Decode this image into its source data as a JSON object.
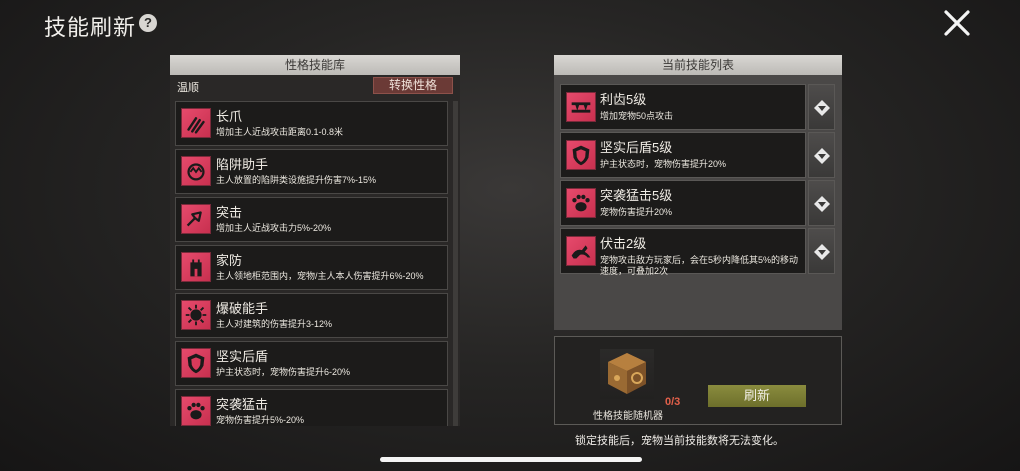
{
  "header": {
    "title": "技能刷新",
    "help_label": "?"
  },
  "library": {
    "title": "性格技能库",
    "personality": "温顺",
    "change_button": "转换性格",
    "skills": [
      {
        "name": "长爪",
        "desc": "增加主人近战攻击距离0.1-0.8米",
        "icon": "claw-icon"
      },
      {
        "name": "陷阱助手",
        "desc": "主人放置的陷阱类设施提升伤害7%-15%",
        "icon": "trap-icon"
      },
      {
        "name": "突击",
        "desc": "增加主人近战攻击力5%-20%",
        "icon": "assault-icon"
      },
      {
        "name": "家防",
        "desc": "主人领地柜范围内，宠物/主人本人伤害提升6%-20%",
        "icon": "tower-icon"
      },
      {
        "name": "爆破能手",
        "desc": "主人对建筑的伤害提升3-12%",
        "icon": "explosion-icon"
      },
      {
        "name": "坚实后盾",
        "desc": "护主状态时，宠物伤害提升6-20%",
        "icon": "shield-icon"
      },
      {
        "name": "突袭猛击",
        "desc": "宠物伤害提升5%-20%",
        "icon": "paw-icon"
      }
    ]
  },
  "current": {
    "title": "当前技能列表",
    "skills": [
      {
        "name": "利齿5级",
        "desc": "增加宠物50点攻击",
        "icon": "fang-icon"
      },
      {
        "name": "坚实后盾5级",
        "desc": "护主状态时，宠物伤害提升20%",
        "icon": "shield-icon"
      },
      {
        "name": "突袭猛击5级",
        "desc": "宠物伤害提升20%",
        "icon": "paw-icon"
      },
      {
        "name": "伏击2级",
        "desc": "宠物攻击敌方玩家后，会在5秒内降低其5%的移动速度，可叠加2次",
        "icon": "ambush-icon"
      }
    ]
  },
  "refresh": {
    "item_name": "性格技能随机器",
    "item_count": "0/3",
    "button_label": "刷新"
  },
  "footer_note": "锁定技能后，宠物当前技能数将无法变化。",
  "colors": {
    "skill_icon": "#d83a5a",
    "refresh_button": "#7a7c35",
    "change_button": "#6b3a36"
  }
}
